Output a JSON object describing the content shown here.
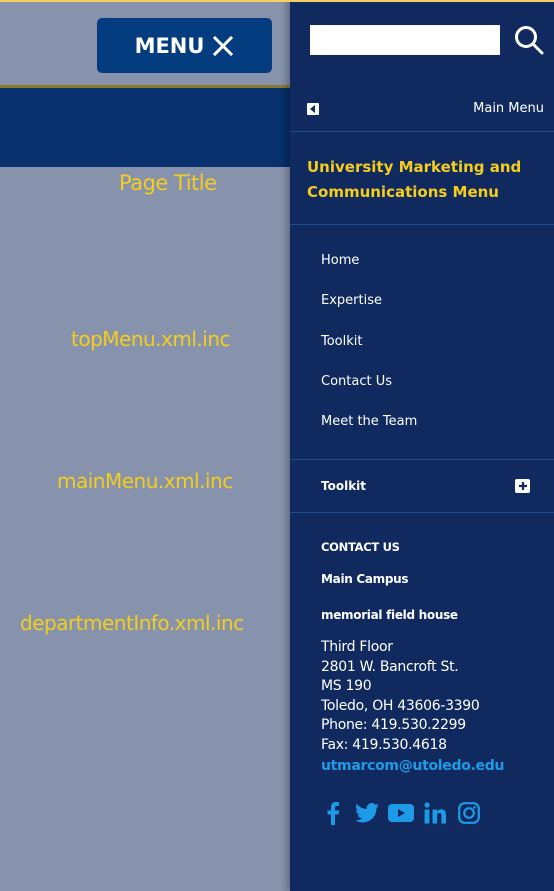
{
  "colors": {
    "page_bg": "#8793ac",
    "header_bar": "#07306d",
    "menu_button": "#033d80",
    "drawer_bg": "#102a5f",
    "accent_yellow": "#f5cd1d",
    "link_blue": "#1e9be8"
  },
  "page": {
    "menu_button": {
      "label": "MENU",
      "icon": "close-icon"
    },
    "annotations": {
      "page_title": "Page Title",
      "top_menu": "topMenu.xml.inc",
      "main_menu": "mainMenu.xml.inc",
      "department_info": "departmentInfo.xml.inc"
    }
  },
  "drawer": {
    "search": {
      "value": "",
      "placeholder": "",
      "icon": "search-icon"
    },
    "back": {
      "icon": "caret-left-icon",
      "label": "Main Menu"
    },
    "section_title": "University Marketing and Communications Menu",
    "nav_items": [
      {
        "label": "Home"
      },
      {
        "label": "Expertise"
      },
      {
        "label": "Toolkit"
      },
      {
        "label": "Contact Us"
      },
      {
        "label": "Meet the Team"
      }
    ],
    "toolkit": {
      "label": "Toolkit",
      "icon": "plus-icon"
    },
    "contact": {
      "heading": "CONTACT US",
      "campus": "Main Campus",
      "building": "memorial field house",
      "address_lines": [
        "Third Floor",
        "2801 W. Bancroft St.",
        "MS 190",
        "Toledo, OH 43606-3390",
        "Phone: 419.530.2299",
        "Fax: 419.530.4618"
      ],
      "email": "utmarcom@utoledo.edu"
    },
    "social": [
      {
        "name": "facebook-icon"
      },
      {
        "name": "twitter-icon"
      },
      {
        "name": "youtube-icon"
      },
      {
        "name": "linkedin-icon"
      },
      {
        "name": "instagram-icon"
      }
    ]
  }
}
